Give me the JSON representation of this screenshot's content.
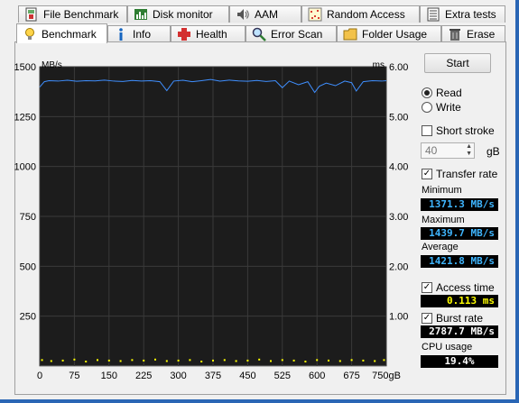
{
  "tabs_top": [
    {
      "label": "File Benchmark",
      "icon": "file-benchmark-icon"
    },
    {
      "label": "Disk monitor",
      "icon": "disk-monitor-icon"
    },
    {
      "label": "AAM",
      "icon": "speaker-icon"
    },
    {
      "label": "Random Access",
      "icon": "random-access-icon"
    },
    {
      "label": "Extra tests",
      "icon": "extra-tests-icon"
    }
  ],
  "tabs_bottom": [
    {
      "label": "Benchmark",
      "icon": "lightbulb-icon",
      "active": true
    },
    {
      "label": "Info",
      "icon": "info-icon"
    },
    {
      "label": "Health",
      "icon": "health-cross-icon"
    },
    {
      "label": "Error Scan",
      "icon": "magnifier-icon"
    },
    {
      "label": "Folder Usage",
      "icon": "folder-icon"
    },
    {
      "label": "Erase",
      "icon": "trash-icon"
    }
  ],
  "controls": {
    "start_label": "Start",
    "read_label": "Read",
    "read_selected": true,
    "write_label": "Write",
    "write_selected": false,
    "short_stroke_label": "Short stroke",
    "short_stroke_checked": false,
    "short_stroke_value": "40",
    "short_stroke_unit": "gB",
    "transfer_rate_label": "Transfer rate",
    "transfer_rate_checked": true,
    "minimum_label": "Minimum",
    "minimum_value": "1371.3 MB/s",
    "maximum_label": "Maximum",
    "maximum_value": "1439.7 MB/s",
    "average_label": "Average",
    "average_value": "1421.8 MB/s",
    "access_time_label": "Access time",
    "access_time_checked": true,
    "access_time_value": "0.113 ms",
    "burst_rate_label": "Burst rate",
    "burst_rate_checked": true,
    "burst_rate_value": "2787.7 MB/s",
    "cpu_usage_label": "CPU usage",
    "cpu_usage_value": "19.4%"
  },
  "colors": {
    "transfer_value": "#3fb6ff",
    "access_value": "#ffff00",
    "cpu_value": "#ffffff",
    "chart_bg": "#1c1c1c",
    "grid": "#3a3a3a",
    "transfer_line": "#3f8fff",
    "access_points": "#ffff00"
  },
  "chart_data": {
    "type": "line",
    "left_axis_unit": "MB/s",
    "right_axis_unit": "ms",
    "x_unit": "gB",
    "xlim": [
      0,
      750
    ],
    "ylim": [
      0,
      1500
    ],
    "y2lim": [
      0,
      6
    ],
    "x_ticks": [
      "0",
      "75",
      "150",
      "225",
      "300",
      "375",
      "450",
      "525",
      "600",
      "675",
      "750gB"
    ],
    "y_ticks": [
      "250",
      "500",
      "750",
      "1000",
      "1250",
      "1500"
    ],
    "y2_ticks": [
      "1.00",
      "2.00",
      "3.00",
      "4.00",
      "5.00",
      "6.00"
    ],
    "grid": true,
    "series": [
      {
        "axis": "left",
        "x": [
          0,
          10,
          20,
          40,
          60,
          80,
          100,
          120,
          140,
          160,
          180,
          200,
          220,
          240,
          260,
          275,
          290,
          310,
          330,
          350,
          370,
          390,
          410,
          430,
          450,
          470,
          490,
          510,
          525,
          540,
          560,
          580,
          595,
          605,
          620,
          640,
          660,
          675,
          685,
          700,
          720,
          740,
          750
        ],
        "y": [
          1398,
          1425,
          1430,
          1428,
          1432,
          1427,
          1430,
          1429,
          1433,
          1428,
          1426,
          1431,
          1428,
          1430,
          1425,
          1380,
          1428,
          1432,
          1425,
          1430,
          1436,
          1428,
          1433,
          1429,
          1427,
          1431,
          1426,
          1430,
          1395,
          1428,
          1410,
          1425,
          1371,
          1402,
          1418,
          1405,
          1428,
          1420,
          1378,
          1425,
          1430,
          1428,
          1430
        ]
      },
      {
        "axis": "right",
        "x": [
          5,
          25,
          50,
          75,
          100,
          125,
          150,
          175,
          200,
          225,
          250,
          275,
          300,
          325,
          350,
          375,
          400,
          425,
          450,
          475,
          500,
          525,
          550,
          575,
          600,
          625,
          650,
          675,
          700,
          725,
          745
        ],
        "y": [
          0.12,
          0.1,
          0.11,
          0.13,
          0.09,
          0.12,
          0.11,
          0.1,
          0.12,
          0.11,
          0.13,
          0.1,
          0.11,
          0.12,
          0.09,
          0.11,
          0.12,
          0.1,
          0.11,
          0.13,
          0.1,
          0.12,
          0.11,
          0.09,
          0.12,
          0.11,
          0.1,
          0.12,
          0.11,
          0.1,
          0.12
        ]
      }
    ]
  }
}
